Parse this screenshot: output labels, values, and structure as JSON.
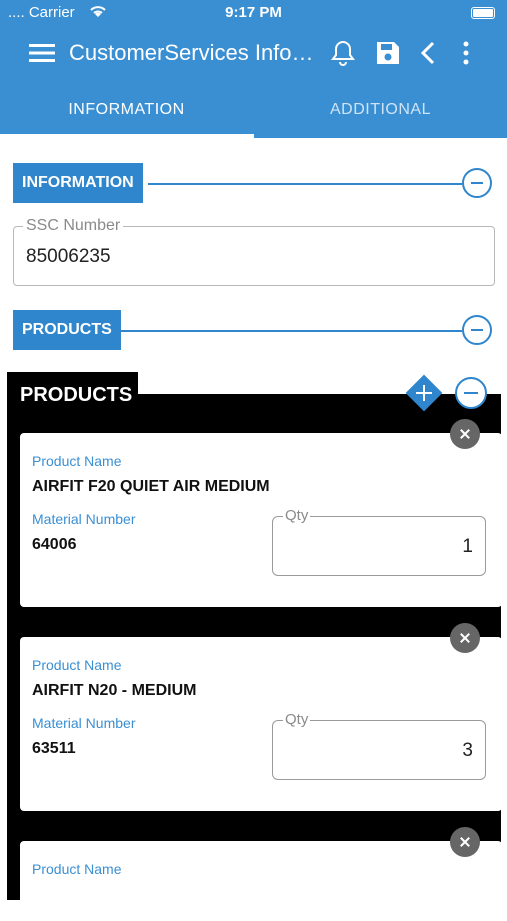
{
  "status": {
    "carrier": ".... Carrier",
    "time": "9:17 PM"
  },
  "toolbar": {
    "title": "CustomerServices Information",
    "icons": [
      "menu-icon",
      "bell-icon",
      "save-icon",
      "back-icon",
      "more-icon"
    ]
  },
  "tabs": [
    {
      "label": "INFORMATION",
      "active": true
    },
    {
      "label": "ADDITIONAL",
      "active": false
    }
  ],
  "information_section": {
    "label": "INFORMATION",
    "ssc": {
      "legend": "SSC Number",
      "value": "85006235"
    }
  },
  "products_section": {
    "label": "PRODUCTS"
  },
  "products_panel": {
    "heading": "PRODUCTS",
    "items": [
      {
        "name_label": "Product Name",
        "name": "AIRFIT F20 QUIET AIR MEDIUM",
        "material_label": "Material Number",
        "material": "64006",
        "qty_legend": "Qty",
        "qty": "1"
      },
      {
        "name_label": "Product Name",
        "name": "AIRFIT N20 - MEDIUM",
        "material_label": "Material Number",
        "material": "63511",
        "qty_legend": "Qty",
        "qty": "3"
      },
      {
        "name_label": "Product Name"
      }
    ]
  },
  "colors": {
    "primary": "#3a8fd3",
    "accent": "#2f86cc"
  }
}
